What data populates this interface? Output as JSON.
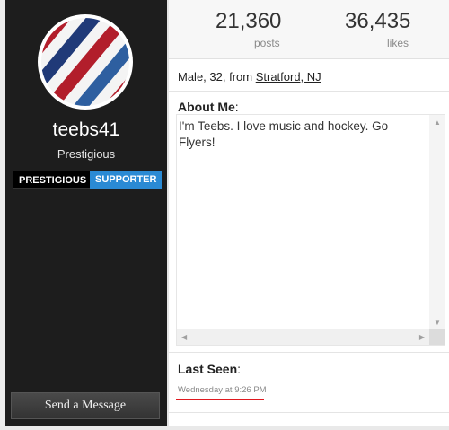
{
  "profile": {
    "username": "teebs41",
    "rank": "Prestigious",
    "badges": [
      "PRESTIGIOUS",
      "SUPPORTER"
    ],
    "send_message_label": "Send a Message",
    "avatar_icon": "barber-pole-avatar"
  },
  "stats": [
    {
      "value": "21,360",
      "label": "posts"
    },
    {
      "value": "36,435",
      "label": "likes"
    }
  ],
  "demographics": {
    "prefix": "Male, 32, from ",
    "location": "Stratford, NJ"
  },
  "about": {
    "title": "About Me",
    "colon": ":",
    "text": "I'm Teebs. I love music and hockey. Go Flyers!"
  },
  "last_seen": {
    "title": "Last Seen",
    "colon": ":",
    "time": "Wednesday at 9:26 PM"
  },
  "colors": {
    "sidebar": "#1d1d1d",
    "supporter_badge": "#2a8ad4",
    "highlight_underline": "#e0191f"
  }
}
